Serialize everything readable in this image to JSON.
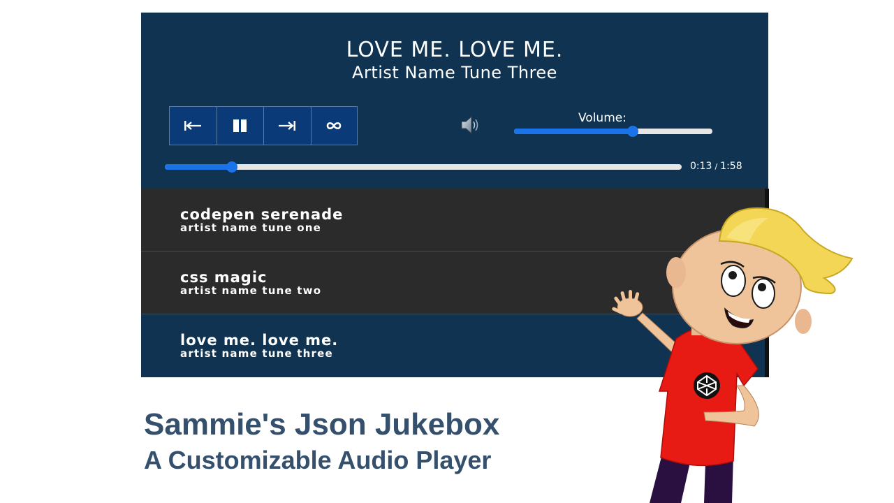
{
  "now_playing": {
    "title": "LOVE ME. LOVE ME.",
    "artist": "Artist Name Tune Three"
  },
  "controls": [
    {
      "name": "previous-button",
      "icon": "skip-previous-icon",
      "glyph": "⇤"
    },
    {
      "name": "pause-button",
      "icon": "pause-icon",
      "glyph": "❚❚"
    },
    {
      "name": "next-button",
      "icon": "skip-next-icon",
      "glyph": "⇥"
    },
    {
      "name": "loop-button",
      "icon": "loop-icon",
      "glyph": "∞"
    }
  ],
  "volume": {
    "label": "Volume:",
    "icon": "speaker-icon",
    "level_fraction": 0.6
  },
  "progress": {
    "current": "0:13",
    "separator": "/",
    "duration": "1:58",
    "fraction": 0.13
  },
  "playlist": [
    {
      "title": "codepen serenade",
      "artist": "artist name tune one",
      "active": false
    },
    {
      "title": "css magic",
      "artist": "artist name tune two",
      "active": false
    },
    {
      "title": "love me. love me.",
      "artist": "artist name tune three",
      "active": true
    }
  ],
  "caption": {
    "title": "Sammie's Json Jukebox",
    "subtitle": "A Customizable Audio Player"
  },
  "colors": {
    "panel": "#0f3350",
    "playlist_row": "#2b2b2b",
    "accent": "#1a73e8",
    "caption": "#34506c"
  }
}
